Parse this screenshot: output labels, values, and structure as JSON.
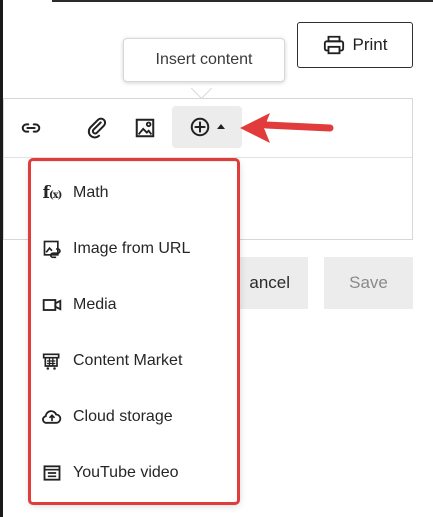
{
  "toolbar": {
    "print_label": "Print",
    "tooltip": "Insert content",
    "icons": [
      "link-icon",
      "paperclip-icon",
      "image-icon",
      "plus-circle-icon"
    ]
  },
  "actions": {
    "cancel_label": "ancel",
    "save_label": "Save"
  },
  "insert_menu": {
    "items": [
      {
        "label": "Math",
        "icon": "math-function-icon"
      },
      {
        "label": "Image from URL",
        "icon": "image-link-icon"
      },
      {
        "label": "Media",
        "icon": "video-camera-icon"
      },
      {
        "label": "Content Market",
        "icon": "cart-icon"
      },
      {
        "label": "Cloud storage",
        "icon": "cloud-upload-icon"
      },
      {
        "label": "YouTube video",
        "icon": "youtube-video-icon"
      }
    ]
  },
  "colors": {
    "highlight": "#e03c3c",
    "button_bg": "#ececec"
  }
}
